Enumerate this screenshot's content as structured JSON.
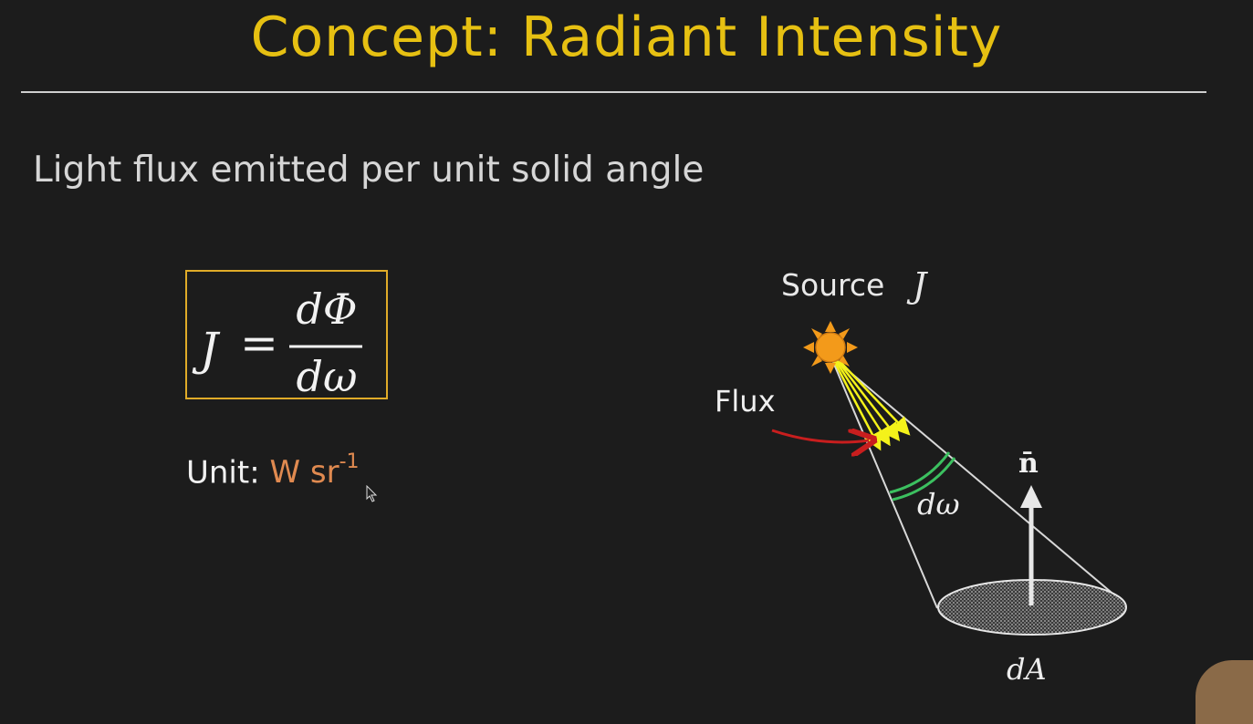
{
  "slide": {
    "title": "Concept: Radiant Intensity",
    "subtitle": "Light flux emitted per unit solid angle"
  },
  "formula": {
    "lhs": "J",
    "equals": "=",
    "numerator": "dΦ",
    "denominator": "dω"
  },
  "unit": {
    "label": "Unit:",
    "value": "W sr",
    "exponent": "-1"
  },
  "diagram": {
    "source_label": "Source",
    "source_symbol": "J",
    "flux_label": "Flux",
    "solid_angle_label": "dω",
    "normal_label": "n̄",
    "area_label": "dA"
  },
  "colors": {
    "title": "#e6c012",
    "formula_border": "#e0ab28",
    "unit_value": "#e08a50",
    "sun": "#f39a1a",
    "rays": "#f4f21a",
    "flux_arrow": "#c81e1e",
    "solid_angle_arc": "#3cc060"
  }
}
